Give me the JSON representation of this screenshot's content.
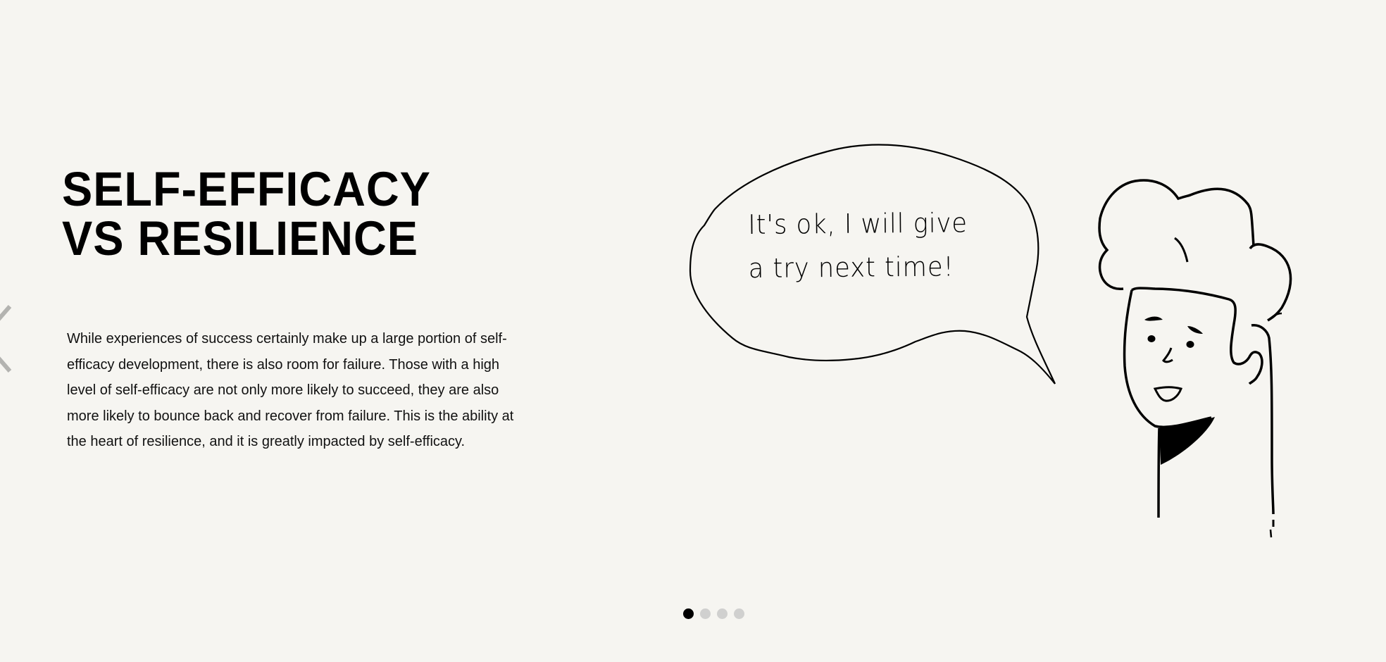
{
  "slide": {
    "title_line1": "SELF-EFFICACY",
    "title_line2": "VS RESILIENCE",
    "body": "While experiences of success certainly make up a large portion of self-efficacy development, there is also room for failure. Those with a high level of self-efficacy are not only more likely to succeed, they are also more likely to bounce back and recover from failure. This is the ability at the heart of resilience, and it is greatly impacted by self-efficacy."
  },
  "speech_bubble": {
    "line1": "It's ok, I will give",
    "line2": "a try next time!"
  },
  "navigation": {
    "prev_icon": "chevron-left-icon",
    "current_page": 1,
    "total_pages": 4
  },
  "colors": {
    "background": "#f6f5f1",
    "text": "#111111",
    "dot_active": "#000000",
    "dot_inactive": "#d0d0cf",
    "arrow": "#b3b3b0"
  }
}
